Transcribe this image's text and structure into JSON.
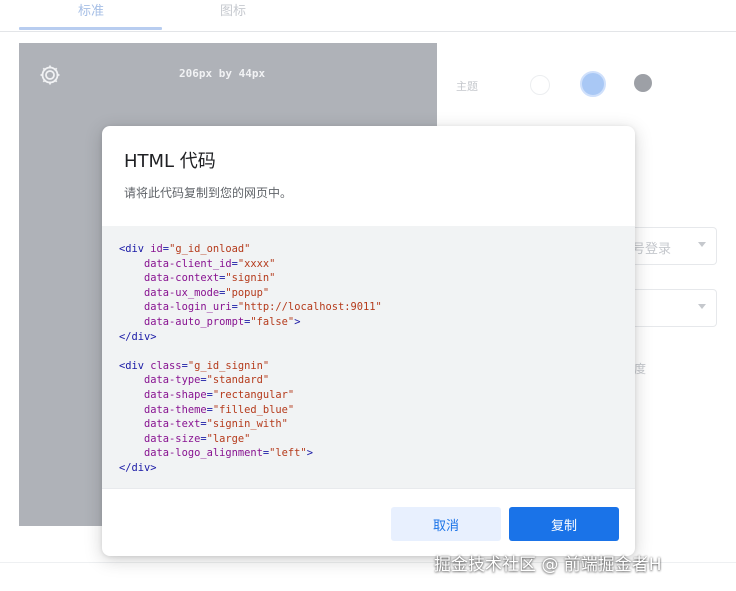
{
  "tabs": [
    {
      "label": "标准",
      "active": true
    },
    {
      "label": "图标",
      "active": false
    }
  ],
  "preview": {
    "size_text": "206px by 44px",
    "icon": "gear-icon"
  },
  "config": {
    "theme_label": "主题",
    "select1_text": "号登录",
    "frag_text": "度"
  },
  "dialog": {
    "title": "HTML 代码",
    "description": "请将此代码复制到您的网页中。",
    "code_blocks": [
      {
        "element": "div",
        "attrs": [
          {
            "name": "id",
            "value": "g_id_onload"
          },
          {
            "name": "data-client_id",
            "value": "xxxx"
          },
          {
            "name": "data-context",
            "value": "signin"
          },
          {
            "name": "data-ux_mode",
            "value": "popup"
          },
          {
            "name": "data-login_uri",
            "value": "http://localhost:9011"
          },
          {
            "name": "data-auto_prompt",
            "value": "false"
          }
        ]
      },
      {
        "element": "div",
        "attrs": [
          {
            "name": "class",
            "value": "g_id_signin"
          },
          {
            "name": "data-type",
            "value": "standard"
          },
          {
            "name": "data-shape",
            "value": "rectangular"
          },
          {
            "name": "data-theme",
            "value": "filled_blue"
          },
          {
            "name": "data-text",
            "value": "signin_with"
          },
          {
            "name": "data-size",
            "value": "large"
          },
          {
            "name": "data-logo_alignment",
            "value": "left"
          }
        ]
      }
    ],
    "cancel_label": "取消",
    "copy_label": "复制"
  },
  "colors": {
    "accent": "#1a73e8",
    "accent_light": "#e8f0fe",
    "code_bg": "#f1f3f4",
    "preview_bg": "#afb2b8"
  },
  "watermark": "掘金技术社区 @ 前端掘金者H"
}
